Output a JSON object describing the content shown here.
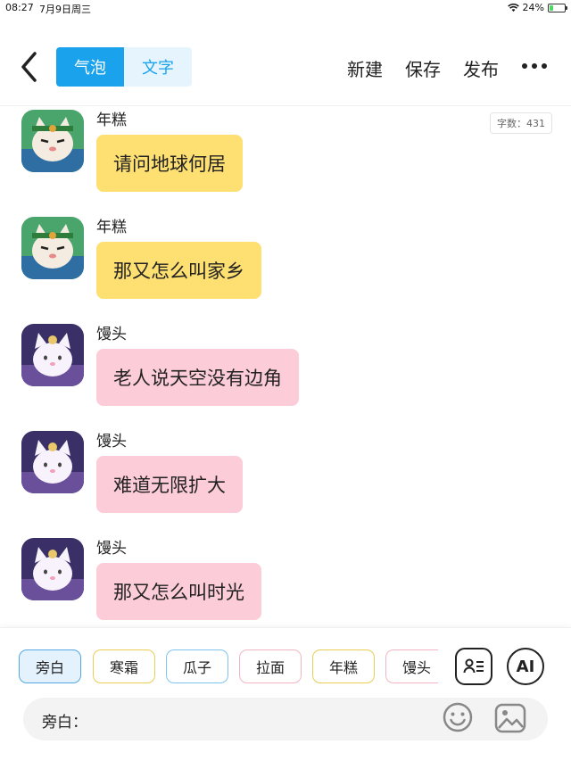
{
  "status_bar": {
    "time": "08:27",
    "date": "7月9日周三",
    "battery_text": "24%",
    "battery_level": 0.24
  },
  "nav": {
    "tabs": [
      {
        "label": "气泡",
        "active": true
      },
      {
        "label": "文字",
        "active": false
      }
    ],
    "actions": {
      "new": "新建",
      "save": "保存",
      "publish": "发布"
    }
  },
  "word_count": "字数：431",
  "messages": [
    {
      "sender": "年糕",
      "text": "请问地球何居",
      "bubble_color": "#fddf72",
      "avatar": "green-cat"
    },
    {
      "sender": "年糕",
      "text": "那又怎么叫家乡",
      "bubble_color": "#fddf72",
      "avatar": "green-cat"
    },
    {
      "sender": "馒头",
      "text": "老人说天空没有边角",
      "bubble_color": "#fcccd8",
      "avatar": "purple-cat"
    },
    {
      "sender": "馒头",
      "text": "难道无限扩大",
      "bubble_color": "#fcccd8",
      "avatar": "purple-cat"
    },
    {
      "sender": "馒头",
      "text": "那又怎么叫时光",
      "bubble_color": "#fcccd8",
      "avatar": "purple-cat"
    }
  ],
  "characters": [
    "旁白",
    "寒霜",
    "瓜子",
    "拉面",
    "年糕",
    "馒头"
  ],
  "tools": {
    "ai_label": "AI"
  },
  "input": {
    "label": "旁白：",
    "value": "",
    "placeholder": ""
  },
  "colors": {
    "accent": "#1aa3ec",
    "yellow_bubble": "#fddf72",
    "pink_bubble": "#fcccd8"
  },
  "icons": [
    "back-icon",
    "more-icon",
    "contact-card-icon",
    "emoji-icon",
    "image-icon",
    "wifi-icon",
    "battery-icon"
  ]
}
